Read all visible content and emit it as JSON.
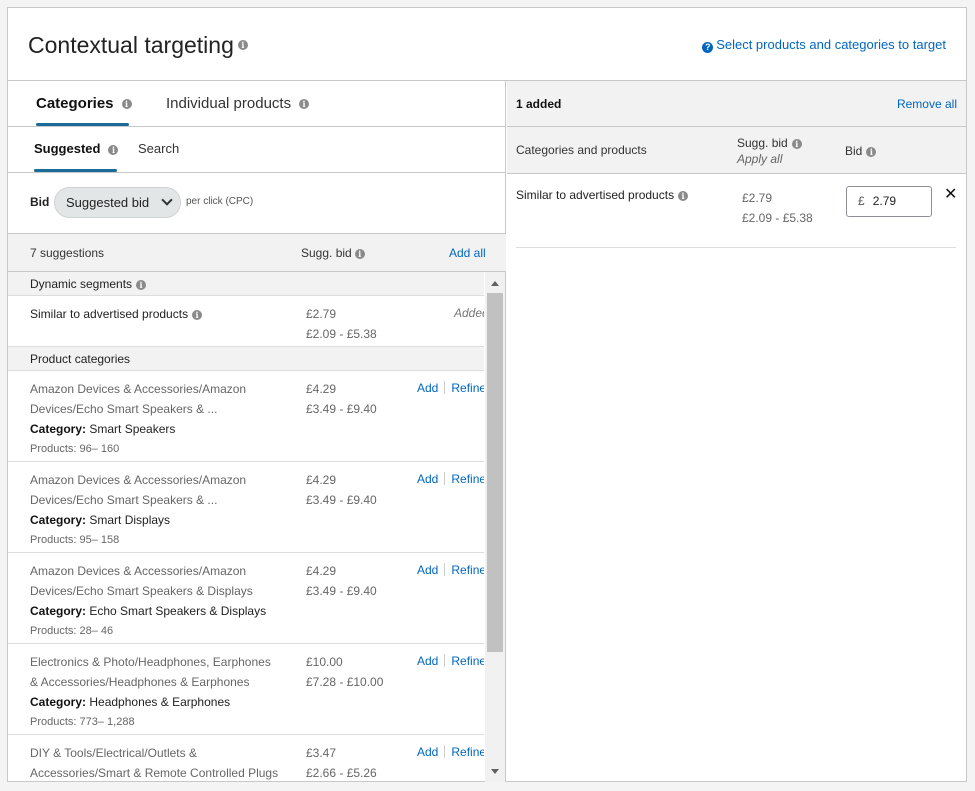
{
  "header": {
    "title": "Contextual targeting",
    "help_link": "Select products and categories to target"
  },
  "tabs": {
    "categories": "Categories",
    "individual_products": "Individual products"
  },
  "subtabs": {
    "suggested": "Suggested",
    "search": "Search"
  },
  "bid": {
    "label": "Bid",
    "select_value": "Suggested bid",
    "per_click": "per click (CPC)"
  },
  "suggestions": {
    "count": "7 suggestions",
    "sugg_bid_header": "Sugg. bid",
    "add_all": "Add all",
    "dynamic_segments_title": "Dynamic segments",
    "dynamic_row": {
      "name": "Similar to advertised products",
      "bid": "£2.79",
      "range": "£2.09 - £5.38",
      "status": "Added"
    },
    "product_categories_title": "Product categories",
    "add_label": "Add",
    "refine_label": "Refine",
    "category_prefix": "Category:",
    "rows": [
      {
        "path_line1": "Amazon Devices & Accessories/Amazon",
        "path_line2": "Devices/Echo Smart Speakers & ...",
        "category": "Smart Speakers",
        "products": "Products: 96– 160",
        "bid": "£4.29",
        "range": "£3.49 - £9.40"
      },
      {
        "path_line1": "Amazon Devices & Accessories/Amazon",
        "path_line2": "Devices/Echo Smart Speakers & ...",
        "category": "Smart Displays",
        "products": "Products: 95– 158",
        "bid": "£4.29",
        "range": "£3.49 - £9.40"
      },
      {
        "path_line1": "Amazon Devices & Accessories/Amazon",
        "path_line2": "Devices/Echo Smart Speakers & Displays",
        "category": "Echo Smart Speakers & Displays",
        "products": "Products: 28– 46",
        "bid": "£4.29",
        "range": "£3.49 - £9.40"
      },
      {
        "path_line1": "Electronics & Photo/Headphones, Earphones",
        "path_line2": "& Accessories/Headphones & Earphones",
        "category": "Headphones & Earphones",
        "products": "Products: 773– 1,288",
        "bid": "£10.00",
        "range": "£7.28 - £10.00"
      },
      {
        "path_line1": "DIY & Tools/Electrical/Outlets &",
        "path_line2": "Accessories/Smart & Remote Controlled Plugs",
        "category": "",
        "products": "",
        "bid": "£3.47",
        "range": "£2.66 - £5.26"
      }
    ]
  },
  "added_panel": {
    "count": "1 added",
    "remove_all": "Remove all",
    "col_categories": "Categories and products",
    "col_sugg_bid": "Sugg. bid",
    "apply_all": "Apply all",
    "col_bid": "Bid",
    "row": {
      "name": "Similar to advertised products",
      "bid": "£2.79",
      "range": "£2.09 - £5.38",
      "currency": "£",
      "input_value": "2.79",
      "remove": "✕"
    }
  }
}
